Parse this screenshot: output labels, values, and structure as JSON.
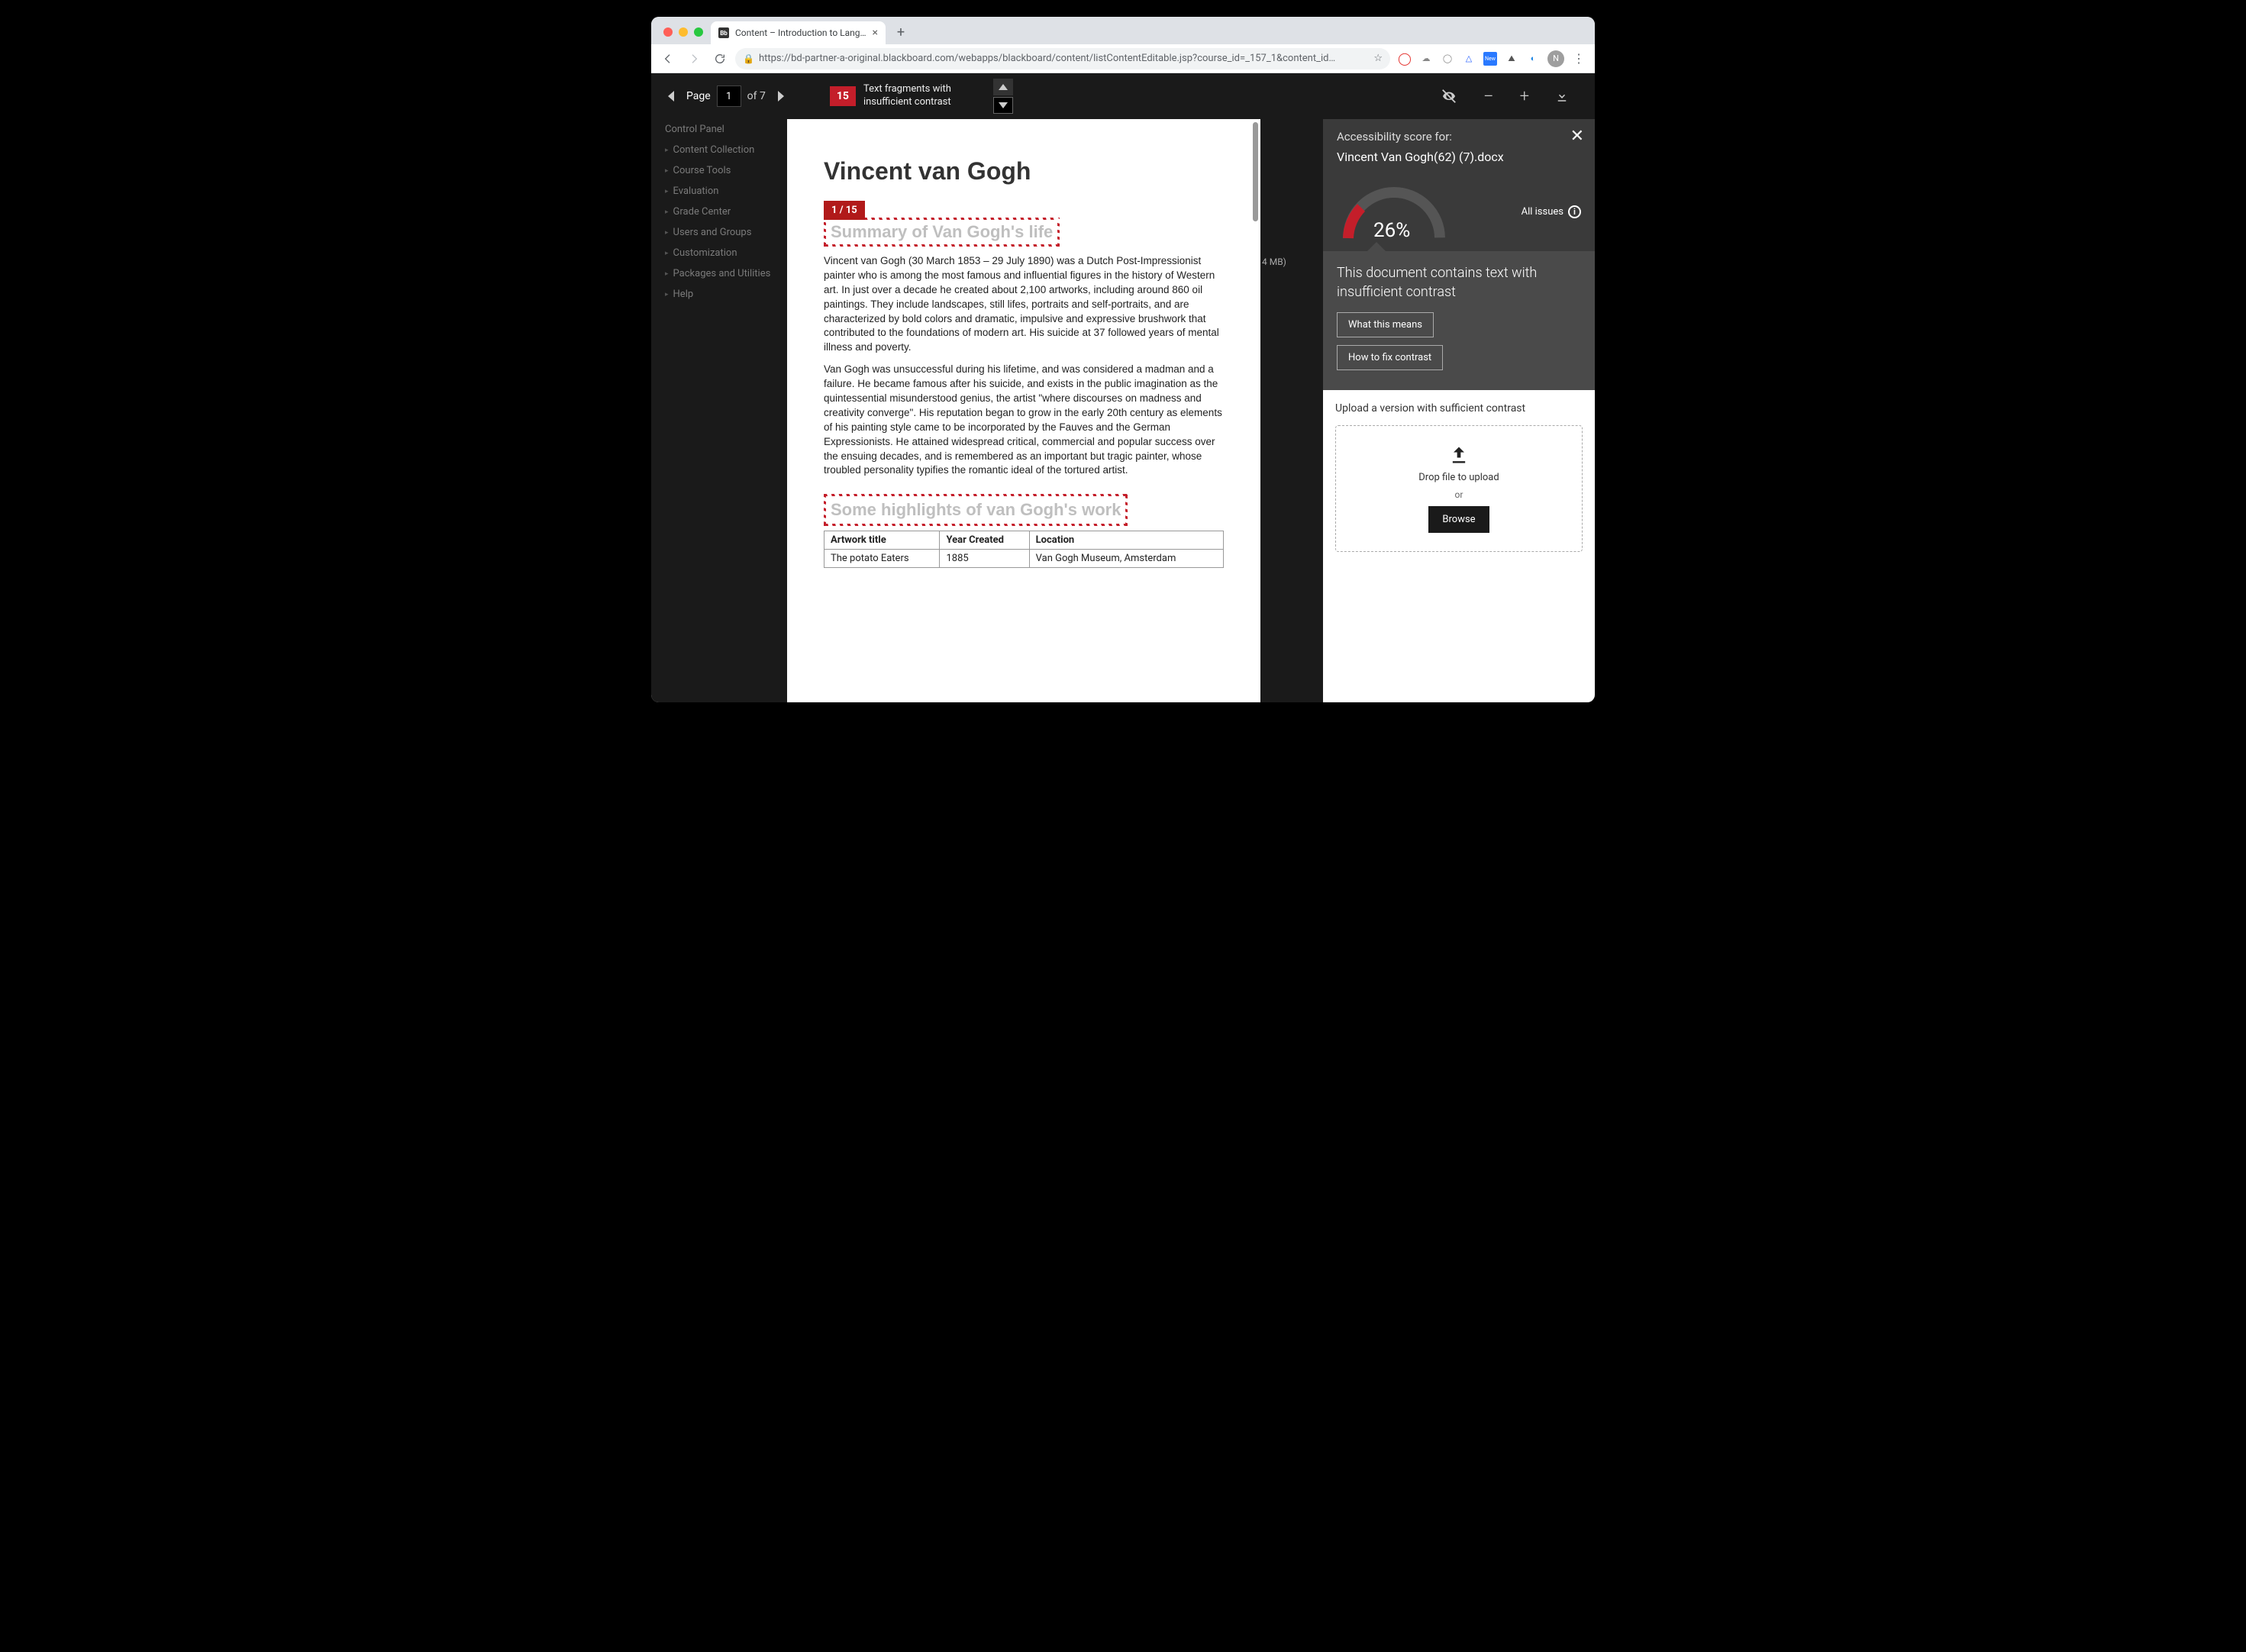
{
  "browser": {
    "tab_title": "Content – Introduction to Lang…",
    "url": "https://bd-partner-a-original.blackboard.com/webapps/blackboard/content/listContentEditable.jsp?course_id=_157_1&content_id…"
  },
  "sidebar_items": [
    "Control Panel",
    "Content Collection",
    "Course Tools",
    "Evaluation",
    "Grade Center",
    "Users and Groups",
    "Customization",
    "Packages and Utilities",
    "Help"
  ],
  "toolbar": {
    "page_label": "Page",
    "page_current": "1",
    "page_total": "of 7",
    "issue_count": "15",
    "issue_text": "Text fragments with insufficient contrast"
  },
  "document": {
    "title": "Vincent van Gogh",
    "badge": "1 / 15",
    "subhead1": "Summary of Van Gogh's life",
    "para1": "Vincent van Gogh (30 March 1853 – 29 July 1890) was a Dutch Post-Impressionist painter who is among the most famous and influential figures in the history of Western art. In just over a decade he created about 2,100 artworks, including around 860 oil paintings. They include landscapes, still lifes, portraits and self-portraits, and are characterized by bold colors and dramatic, impulsive and expressive brushwork that contributed to the foundations of modern art. His suicide at 37 followed years of mental illness and poverty.",
    "para2": "Van Gogh was unsuccessful during his lifetime, and was considered a madman and a failure. He became famous after his suicide, and exists in the public imagination as the quintessential misunderstood genius, the artist \"where discourses on madness and creativity converge\".  His reputation began to grow in the early 20th century as elements of his painting style came to be incorporated by the Fauves and the German Expressionists. He attained widespread critical, commercial and popular success over the ensuing decades, and is remembered as an important but tragic painter, whose troubled personality typifies the romantic ideal of the tortured artist.",
    "subhead2": "Some highlights of van Gogh's work",
    "table": {
      "headers": [
        "Artwork title",
        "Year Created",
        "Location"
      ],
      "row": [
        "The potato Eaters",
        "1885",
        "Van Gogh Museum, Amsterdam"
      ]
    },
    "filesize_hint": "4 MB)"
  },
  "panel": {
    "score_label": "Accessibility score for:",
    "filename": "Vincent Van Gogh(62) (7).docx",
    "score": "26%",
    "all_issues": "All issues",
    "issue_title": "This document contains text with insufficient contrast",
    "btn1": "What this means",
    "btn2": "How to fix contrast",
    "upload_title": "Upload a version with sufficient contrast",
    "drop1": "Drop file to upload",
    "drop2": "or",
    "browse": "Browse"
  }
}
